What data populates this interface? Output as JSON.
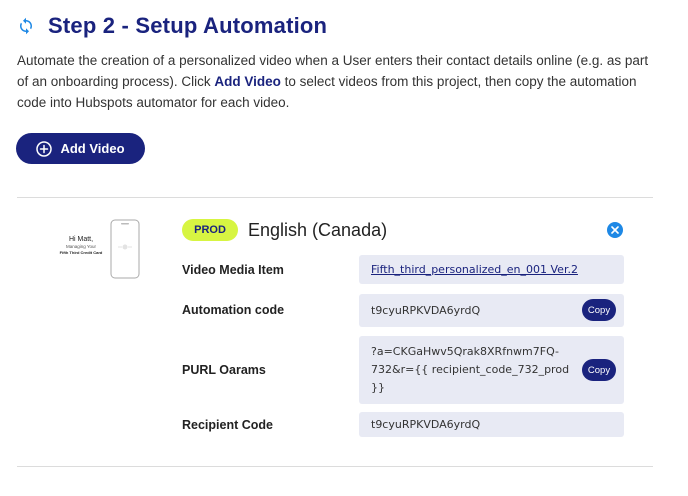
{
  "header": {
    "title": "Step 2 - Setup Automation",
    "icon": "sync-icon"
  },
  "description": {
    "part1": "Automate the creation of a personalized video when a User enters their contact details online (e.g. as part of an onboarding process). Click ",
    "link": "Add Video",
    "part2": " to select videos from this project, then copy the automation code into Hubspots automator for each video."
  },
  "add_video_button": {
    "label": "Add Video",
    "icon": "plus-circle-icon"
  },
  "video_card": {
    "thumbnail": {
      "line1": "Hi Matt,",
      "line2": "Managing Your",
      "line3": "Fifth Third Credit Card"
    },
    "badge": "PROD",
    "language": "English (Canada)",
    "rows": [
      {
        "label": "Video Media Item",
        "value": "Fifth_third_personalized_en_001 Ver.2"
      },
      {
        "label": "Automation code",
        "value": "t9cyuRPKVDA6yrdQ",
        "copy_label": "Copy"
      },
      {
        "label": "PURL Oarams",
        "value_line1": "?a=CKGaHwv5Qrak8XRfnwm7FQ-",
        "value_line2": "732&r={{ recipient_code_732_prod",
        "value_line3": "}}",
        "copy_label": "Copy"
      },
      {
        "label": "Recipient Code",
        "value": "t9cyuRPKVDA6yrdQ"
      }
    ]
  },
  "colors": {
    "primary": "#1a237e",
    "badge": "#d7f542",
    "close": "#1e88e5",
    "field_bg": "#e8eaf4"
  }
}
